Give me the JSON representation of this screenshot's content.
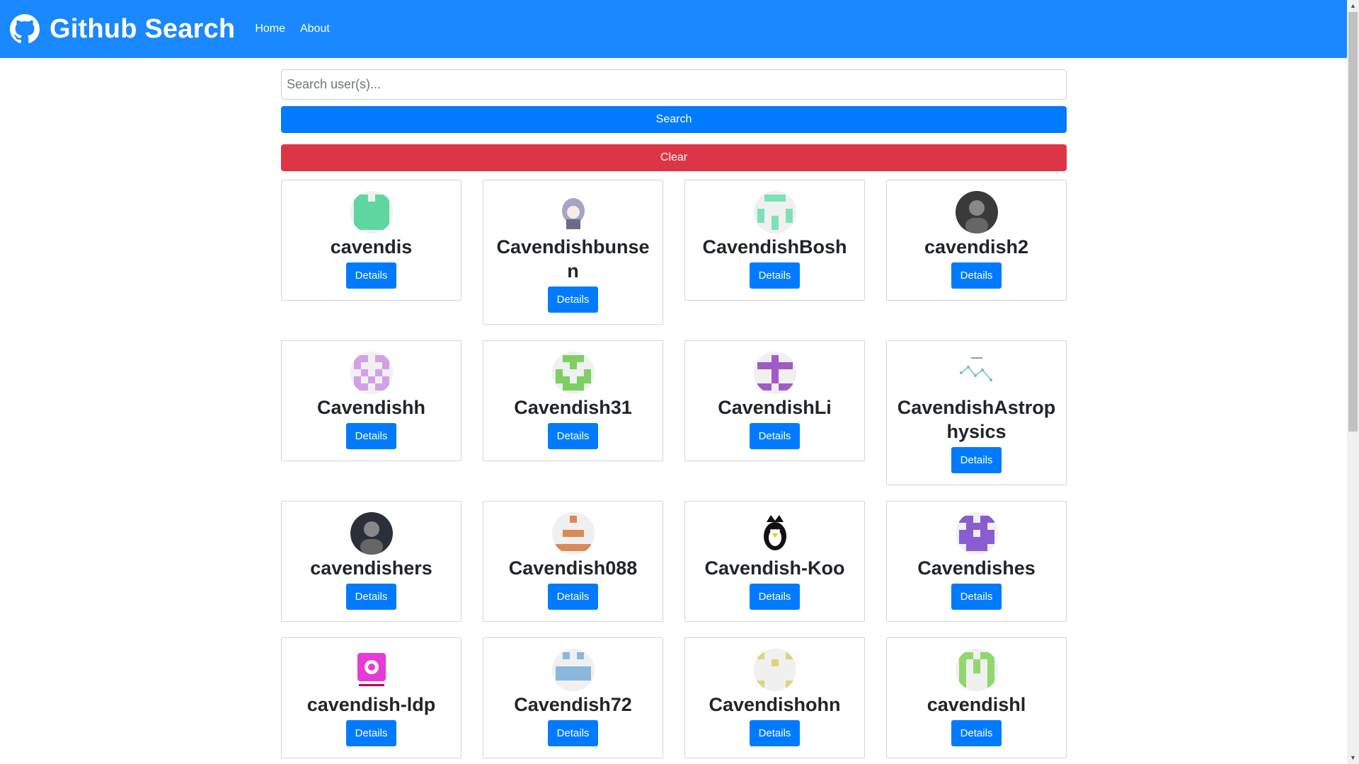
{
  "navbar": {
    "brand_icon": "github-icon",
    "title": "Github Search",
    "links": [
      "Home",
      "About"
    ],
    "background": "#1a88ff"
  },
  "search": {
    "placeholder": "Search user(s)...",
    "value": "",
    "search_label": "Search",
    "clear_label": "Clear"
  },
  "users": [
    {
      "login": "cavendis",
      "avatar": "identicon",
      "color": "#5fd6a0",
      "details_label": "Details"
    },
    {
      "login": "Cavendishbunsen",
      "avatar": "anime-girl-image",
      "color": "#a7a3c4",
      "details_label": "Details"
    },
    {
      "login": "CavendishBosh",
      "avatar": "identicon",
      "color": "#7fe0b8",
      "details_label": "Details"
    },
    {
      "login": "cavendish2",
      "avatar": "photo",
      "color": "#3a3a3a",
      "details_label": "Details"
    },
    {
      "login": "Cavendishh",
      "avatar": "identicon",
      "color": "#d3a0e6",
      "details_label": "Details"
    },
    {
      "login": "Cavendish31",
      "avatar": "identicon",
      "color": "#7ccf60",
      "details_label": "Details"
    },
    {
      "login": "CavendishLi",
      "avatar": "identicon",
      "color": "#a15bc4",
      "details_label": "Details"
    },
    {
      "login": "CavendishAstrophysics",
      "avatar": "constellation-logo",
      "color": "#6fc3a8",
      "details_label": "Details"
    },
    {
      "login": "cavendishers",
      "avatar": "photo",
      "color": "#2b2f3a",
      "details_label": "Details"
    },
    {
      "login": "Cavendish088",
      "avatar": "identicon",
      "color": "#d98a56",
      "details_label": "Details"
    },
    {
      "login": "Cavendish-Koo",
      "avatar": "penguin-image",
      "color": "#111111",
      "details_label": "Details"
    },
    {
      "login": "Cavendishes",
      "avatar": "identicon",
      "color": "#8a5cd1",
      "details_label": "Details"
    },
    {
      "login": "cavendish-ldp",
      "avatar": "logo-image",
      "color": "#e83bd6",
      "details_label": "Details"
    },
    {
      "login": "Cavendish72",
      "avatar": "identicon",
      "color": "#8ab8dc",
      "details_label": "Details"
    },
    {
      "login": "Cavendishohn",
      "avatar": "identicon",
      "color": "#dcd57a",
      "details_label": "Details"
    },
    {
      "login": "cavendishl",
      "avatar": "identicon",
      "color": "#8fd86e",
      "details_label": "Details"
    }
  ],
  "colors": {
    "primary": "#007bff",
    "danger": "#dc3545"
  }
}
